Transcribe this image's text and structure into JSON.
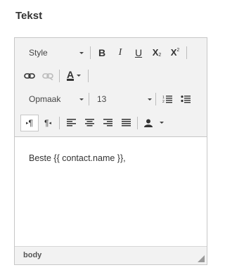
{
  "heading": "Tekst",
  "toolbar": {
    "style_combo": "Style",
    "format_combo": "Opmaak",
    "size_combo": "13",
    "bold": "B",
    "italic": "I",
    "underline": "U",
    "subscript": "X",
    "superscript": "X",
    "text_color": "A",
    "ltr_symbol": "¶",
    "rtl_symbol": "¶"
  },
  "content": {
    "text": "Beste {{ contact.name }},"
  },
  "statusbar": {
    "path": "body"
  },
  "icons": {
    "link": "link-icon",
    "unlink": "unlink-icon",
    "numbered_list": "numbered-list-icon",
    "bulleted_list": "bulleted-list-icon",
    "align_left": "align-left-icon",
    "align_center": "align-center-icon",
    "align_right": "align-right-icon",
    "justify": "justify-icon",
    "placeholder": "person-icon"
  }
}
